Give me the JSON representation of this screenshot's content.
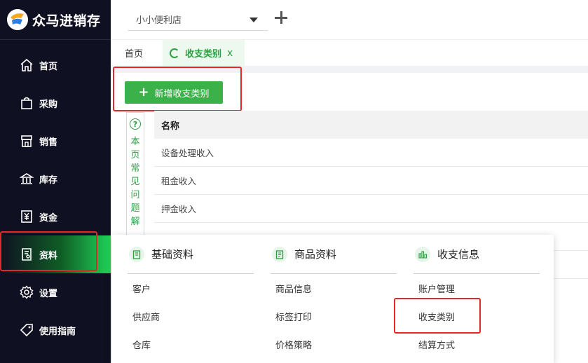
{
  "app": {
    "name": "众马进销存"
  },
  "sidebar": {
    "items": [
      {
        "label": "首页",
        "icon": "home-icon"
      },
      {
        "label": "采购",
        "icon": "shopping-bag-icon"
      },
      {
        "label": "销售",
        "icon": "store-icon"
      },
      {
        "label": "库存",
        "icon": "warehouse-icon"
      },
      {
        "label": "资金",
        "icon": "yen-icon"
      },
      {
        "label": "资料",
        "icon": "document-icon",
        "active": true
      },
      {
        "label": "设置",
        "icon": "gear-icon"
      },
      {
        "label": "使用指南",
        "icon": "tag-icon"
      }
    ]
  },
  "topbar": {
    "store": "小小便利店"
  },
  "tabs": {
    "home": "首页",
    "active": "收支类别",
    "close": "x"
  },
  "toolbar": {
    "add_label": "新增收支类别",
    "add_icon": "+"
  },
  "faq": {
    "icon": "?",
    "text": [
      "本",
      "页",
      "常",
      "见",
      "问",
      "题",
      "解"
    ]
  },
  "table": {
    "header": "名称",
    "rows": [
      "设备处理收入",
      "租金收入",
      "押金收入"
    ]
  },
  "menu": {
    "columns": [
      {
        "title": "基础资料",
        "icon": "clipboard-icon",
        "items": [
          "客户",
          "供应商",
          "仓库"
        ]
      },
      {
        "title": "商品资料",
        "icon": "list-icon",
        "items": [
          "商品信息",
          "标签打印",
          "价格策略"
        ]
      },
      {
        "title": "收支信息",
        "icon": "bar-chart-icon",
        "items": [
          "账户管理",
          "收支类别",
          "结算方式"
        ]
      }
    ]
  },
  "colors": {
    "sidebar_bg": "#0f1021",
    "accent": "#3bb14a",
    "highlight": "#e02a2a"
  }
}
